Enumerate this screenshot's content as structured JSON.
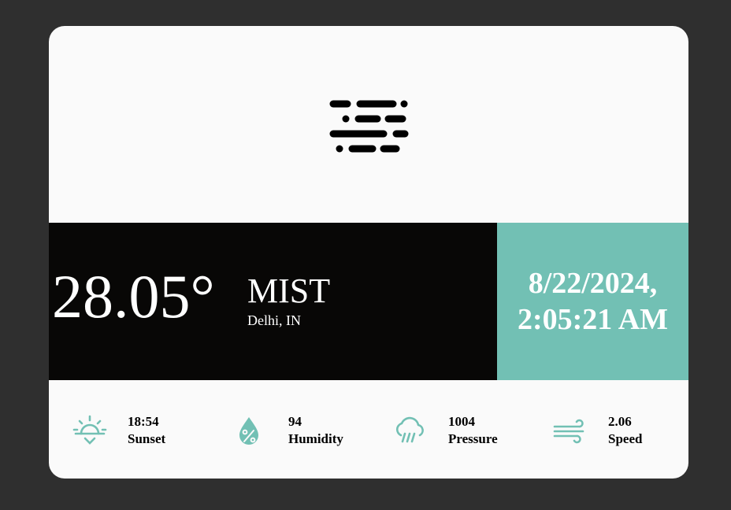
{
  "weather": {
    "icon": "mist-icon",
    "temperature": "28.05°",
    "condition": "MIST",
    "location": "Delhi, IN"
  },
  "datetime": {
    "date": "8/22/2024,",
    "time": "2:05:21 AM"
  },
  "stats": [
    {
      "icon": "sunset-icon",
      "value": "18:54",
      "label": "Sunset"
    },
    {
      "icon": "humidity-icon",
      "value": "94",
      "label": "Humidity"
    },
    {
      "icon": "pressure-icon",
      "value": "1004",
      "label": "Pressure"
    },
    {
      "icon": "wind-icon",
      "value": "2.06",
      "label": "Speed"
    }
  ],
  "colors": {
    "background": "#2f2f2f",
    "card": "#fafafa",
    "dark_panel": "#080706",
    "accent": "#72c0b4"
  }
}
